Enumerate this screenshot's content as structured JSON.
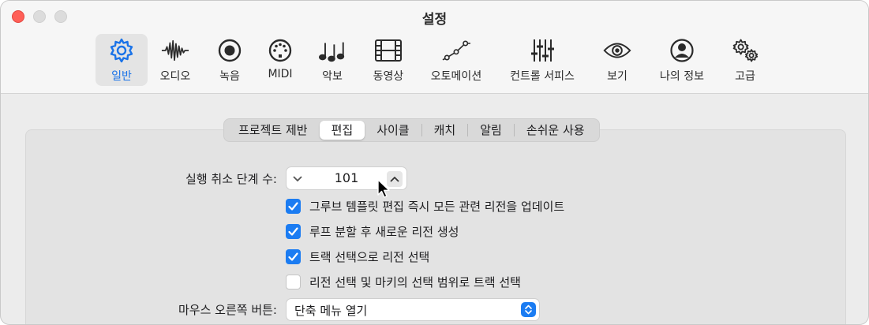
{
  "window": {
    "title": "설정"
  },
  "toolbar": {
    "items": [
      {
        "label": "일반",
        "icon": "gear-icon",
        "selected": true
      },
      {
        "label": "오디오",
        "icon": "waveform-icon"
      },
      {
        "label": "녹음",
        "icon": "record-icon"
      },
      {
        "label": "MIDI",
        "icon": "midi-connector-icon"
      },
      {
        "label": "악보",
        "icon": "music-notes-icon"
      },
      {
        "label": "동영상",
        "icon": "film-icon"
      },
      {
        "label": "오토메이션",
        "icon": "automation-curve-icon"
      },
      {
        "label": "컨트롤 서피스",
        "icon": "faders-icon"
      },
      {
        "label": "보기",
        "icon": "eye-icon"
      },
      {
        "label": "나의 정보",
        "icon": "person-icon"
      },
      {
        "label": "고급",
        "icon": "gears-icon"
      }
    ]
  },
  "tabs": [
    "프로젝트 제반",
    "편집",
    "사이클",
    "캐치",
    "알림",
    "손쉬운 사용"
  ],
  "active_tab": "편집",
  "undo": {
    "label": "실행 취소 단계 수:",
    "value": "101"
  },
  "checkboxes": [
    {
      "label": "그루브 템플릿 편집 즉시 모든 관련 리전을 업데이트",
      "checked": true
    },
    {
      "label": "루프 분할 후 새로운 리전 생성",
      "checked": true
    },
    {
      "label": "트랙 선택으로 리전 선택",
      "checked": true
    },
    {
      "label": "리전 선택 및 마키의 선택 범위로 트랙 선택",
      "checked": false
    }
  ],
  "right_mouse": {
    "label": "마우스 오른쪽 버튼:",
    "value": "단축 메뉴 열기"
  },
  "colors": {
    "accent": "#1b7cf2",
    "close": "#ff5f57"
  }
}
